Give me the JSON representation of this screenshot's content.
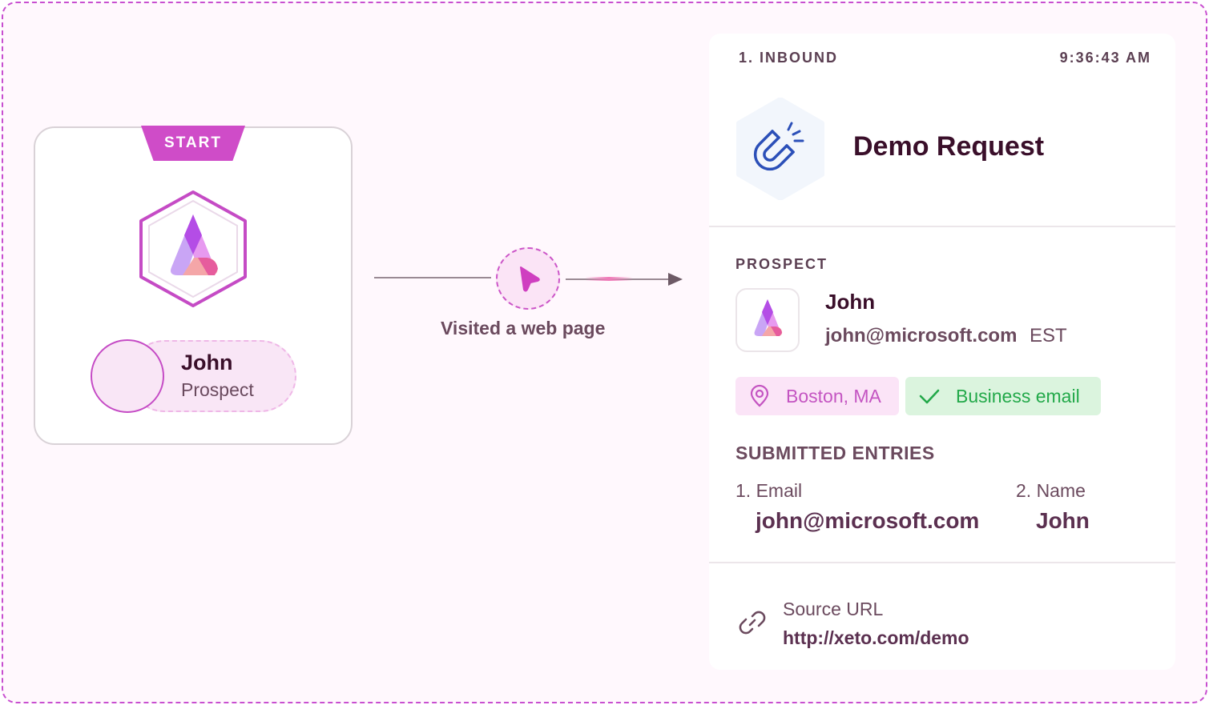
{
  "start_node": {
    "badge": "START",
    "prospect": {
      "name": "John",
      "role": "Prospect"
    }
  },
  "connector": {
    "label": "Visited a web page"
  },
  "event_card": {
    "step": "1. INBOUND",
    "time": "9:36:43 AM",
    "title": "Demo Request",
    "prospect_section": "PROSPECT",
    "prospect": {
      "name": "John",
      "email": "john@microsoft.com",
      "timezone": "EST"
    },
    "tags": [
      {
        "label": "Boston, MA",
        "icon": "location-pin-icon",
        "color": "#c455c2"
      },
      {
        "label": "Business email",
        "icon": "check-icon",
        "color": "#23a94a"
      }
    ],
    "entries_title": "SUBMITTED ENTRIES",
    "entries": [
      {
        "label": "1. Email",
        "value": "john@microsoft.com"
      },
      {
        "label": "2. Name",
        "value": "John"
      }
    ],
    "source": {
      "label": "Source URL",
      "url": "http://xeto.com/demo"
    }
  },
  "colors": {
    "accent": "#cf4cc8",
    "frame_border": "#c84fd0",
    "success": "#23a94a",
    "text_dark": "#3a0f2a"
  }
}
